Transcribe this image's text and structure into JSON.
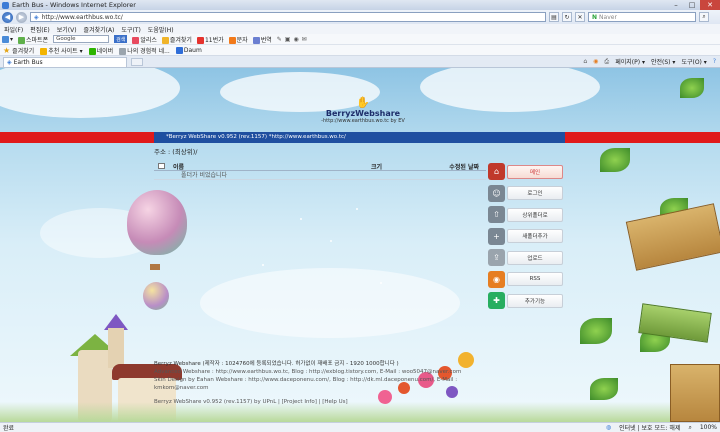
{
  "window": {
    "title": "Earth Bus - Windows Internet Explorer"
  },
  "address_bar": {
    "url": "http://www.earthbus.wo.tc/",
    "search_placeholder": "Naver"
  },
  "menu": [
    "파일(F)",
    "편집(E)",
    "보기(V)",
    "즐겨찾기(A)",
    "도구(T)",
    "도움말(H)"
  ],
  "toolbar1": {
    "left_label": "스마트폰",
    "google_text": "Google",
    "search_btn": "검색",
    "items": [
      "알리스",
      "즐겨찾기",
      "11번가",
      "문자",
      "번역"
    ]
  },
  "favorites_bar": {
    "label": "즐겨찾기",
    "items": [
      "추천 사이트 ▾",
      "네이버",
      "나의 경험적 네...",
      "Daum"
    ]
  },
  "tab": {
    "label": "Earth Bus"
  },
  "command_bar": [
    "페이지(P) ▾",
    "안전(S) ▾",
    "도구(O) ▾"
  ],
  "page": {
    "logo": {
      "brand": "BerryzWebshare",
      "url": "-http://www.earthbus.wo.tc by EV"
    },
    "info_bar": "*Berryz WebShare v0.952 (rev.1157)   *http://www.earthbus.wo.tc/",
    "address_label": "주소 : (최상위)/",
    "columns": {
      "name": "이름",
      "size": "크기",
      "date": "수정된 날짜"
    },
    "empty_message": "폴더가 비었습니다",
    "side_menu": [
      {
        "label": "메인",
        "icon": "home-icon",
        "color": "#c0392b"
      },
      {
        "label": "로그인",
        "icon": "user-icon",
        "color": "#7a8793"
      },
      {
        "label": "상위폴더로",
        "icon": "folder-up-icon",
        "color": "#7a8793"
      },
      {
        "label": "새폴더추가",
        "icon": "new-folder-icon",
        "color": "#7a8793"
      },
      {
        "label": "업로드",
        "icon": "upload-icon",
        "color": "#9aa4ad"
      },
      {
        "label": "RSS",
        "icon": "rss-icon",
        "color": "#e67e22"
      },
      {
        "label": "추가기능",
        "icon": "addon-icon",
        "color": "#27ae60"
      }
    ],
    "footer": {
      "line1": "Berryz Webshare (제작자 : 1024760에 등록되었습니다. 허가없이 재배포 금지 - 1920 1000합니다 )",
      "line2": "Advanced Webshare : http://www.earthbus.wo.tc, Blog : http://exblog.tistory.com, E-Mail : woo5047@naver.com",
      "line3": "Skin Design by Eahan Webshare : http://www.daceponenu.com/, Blog : http://dk.ml.daceponenu.com/, E-Mail : kmkom@naver.com",
      "line4": "Berryz WebShare v0.952 (rev.1157) by UPnL | [Project Info] | [Help Us]"
    }
  },
  "status_bar": {
    "left": "완료",
    "zone": "인터넷 | 보호 모드: 해제",
    "zoom": "100%"
  }
}
